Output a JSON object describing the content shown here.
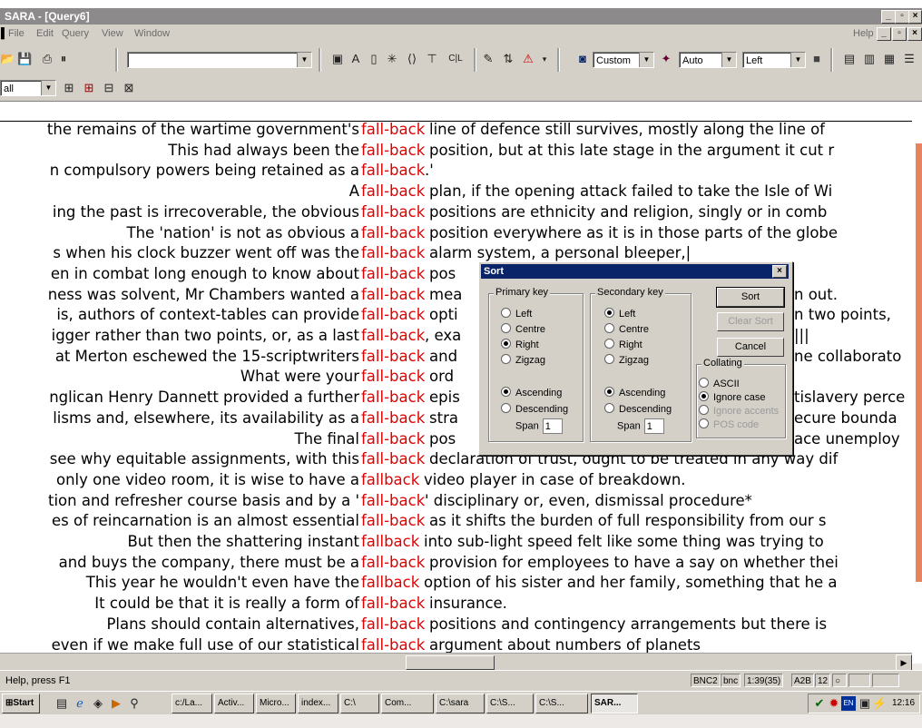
{
  "window": {
    "title": "SARA - [Query6]",
    "min_label": "_",
    "restore_label": "▫",
    "close_label": "×"
  },
  "menu": {
    "items": [
      "File",
      "Edit",
      "Query",
      "View",
      "Window"
    ],
    "help": "Help"
  },
  "toolbar": {
    "query_combo_value": "",
    "style_combo": "Custom",
    "width_combo": "Auto",
    "align_combo": "Left",
    "scope_combo": "all",
    "text_a": "A",
    "text_cl": "C|L"
  },
  "concordance": [
    {
      "left": "the remains of the wartime government's",
      "keyword": "fall-back",
      "right": "line of defence still survives, mostly along the line of"
    },
    {
      "left": "This had always been the",
      "keyword": "fall-back",
      "right": "position, but at this late stage in the argument it cut r"
    },
    {
      "left": "n compulsory powers being retained as a",
      "keyword": "fall-back",
      "right": ".'"
    },
    {
      "left": "A",
      "keyword": "fall-back",
      "right": "plan, if the opening attack failed to take the Isle of Wi"
    },
    {
      "left": "ing the past is irrecoverable, the obvious",
      "keyword": "fall-back",
      "right": "positions are ethnicity and religion, singly or in comb"
    },
    {
      "left": "The 'nation' is not as obvious a",
      "keyword": "fall-back",
      "right": "position everywhere as it is in those parts of the globe"
    },
    {
      "left": "s when his clock buzzer went off was the",
      "keyword": "fall-back",
      "right": "alarm system, a personal bleeper,|"
    },
    {
      "left": "en in combat long enough to know about",
      "keyword": "fall-back",
      "right": "pos"
    },
    {
      "left": "ness was solvent, Mr Chambers wanted a",
      "keyword": "fall-back",
      "right": "mea"
    },
    {
      "left": "is, authors of context-tables can provide",
      "keyword": "fall-back",
      "right": "opti"
    },
    {
      "left": "igger rather than two points, or, as a last",
      "keyword": "fall-back",
      "right": ", exa"
    },
    {
      "left": "at Merton eschewed the 15-scriptwriters",
      "keyword": "fall-back",
      "right": "and"
    },
    {
      "left": "What were your",
      "keyword": "fall-back",
      "right": "ord"
    },
    {
      "left": "nglican Henry Dannett provided a further",
      "keyword": "fall-back",
      "right": "epis"
    },
    {
      "left": "lisms and, elsewhere, its availability as a",
      "keyword": "fall-back",
      "right": "stra"
    },
    {
      "left": "The final",
      "keyword": "fall-back",
      "right": "pos"
    },
    {
      "left": "see why equitable assignments, with this",
      "keyword": "fall-back",
      "right": "declaration of trust, ought to be treated in any way dif"
    },
    {
      "left": "only one video room, it is wise to have a",
      "keyword": "fallback",
      "right": "video player in case of breakdown."
    },
    {
      "left": "tion and refresher course basis and by a '",
      "keyword": "fall-back",
      "right": "' disciplinary or, even, dismissal procedure*"
    },
    {
      "left": "es of reincarnation is an almost essential",
      "keyword": "fall-back",
      "right": "as it shifts the burden of full responsibility from our s"
    },
    {
      "left": "But then the shattering instant",
      "keyword": "fallback",
      "right": "into sub-light speed felt like some thing was trying to"
    },
    {
      "left": "and buys the company, there must be a",
      "keyword": "fall-back",
      "right": "provision for employees to have a say on whether thei"
    },
    {
      "left": "This year he wouldn't even have the",
      "keyword": "fallback",
      "right": "option of his sister and her family, something that he a"
    },
    {
      "left": "It could be that it is really a form of",
      "keyword": "fall-back",
      "right": "insurance."
    },
    {
      "left": "Plans should contain alternatives,",
      "keyword": "fall-back",
      "right": "positions and contingency arrangements but there is"
    },
    {
      "left": "even if we make full use of our statistical",
      "keyword": "fall-back",
      "right": "argument about numbers of planets"
    }
  ],
  "right_fragments": [
    {
      "row": 8,
      "text": "n out."
    },
    {
      "row": 9,
      "text": "n two points,"
    },
    {
      "row": 10,
      "text": "|||"
    },
    {
      "row": 11,
      "text": "ne collaborato"
    },
    {
      "row": 13,
      "text": "tislavery perce"
    },
    {
      "row": 14,
      "text": "ecure bounda"
    },
    {
      "row": 15,
      "text": "ace unemploy"
    }
  ],
  "sort_dialog": {
    "title": "Sort",
    "primary": {
      "caption": "Primary key",
      "options": [
        "Left",
        "Centre",
        "Right",
        "Zigzag"
      ],
      "selected": "Right",
      "order": [
        "Ascending",
        "Descending"
      ],
      "order_selected": "Ascending",
      "span_label": "Span",
      "span_value": "1"
    },
    "secondary": {
      "caption": "Secondary key",
      "options": [
        "Left",
        "Centre",
        "Right",
        "Zigzag"
      ],
      "selected": "Left",
      "order": [
        "Ascending",
        "Descending"
      ],
      "order_selected": "Ascending",
      "span_label": "Span",
      "span_value": "1"
    },
    "buttons": {
      "sort": "Sort",
      "clear_sort": "Clear Sort",
      "cancel": "Cancel"
    },
    "collating": {
      "caption": "Collating",
      "options": [
        "ASCII",
        "Ignore case",
        "Ignore accents",
        "POS code"
      ],
      "selected": "Ignore case"
    }
  },
  "status": {
    "text": "Help, press F1",
    "panes": [
      "BNC2",
      "bnc",
      "1:39(35)",
      "A2B",
      "12"
    ]
  },
  "taskbar": {
    "start": "Start",
    "buttons": [
      "c:/La...",
      "Activ...",
      "Micro...",
      "index...",
      "C:\\",
      "Com...",
      "C:\\sara",
      "C:\\S...",
      "C:\\S...",
      "SAR..."
    ],
    "active": "SAR...",
    "clock": "12:16",
    "lang": "EN"
  }
}
